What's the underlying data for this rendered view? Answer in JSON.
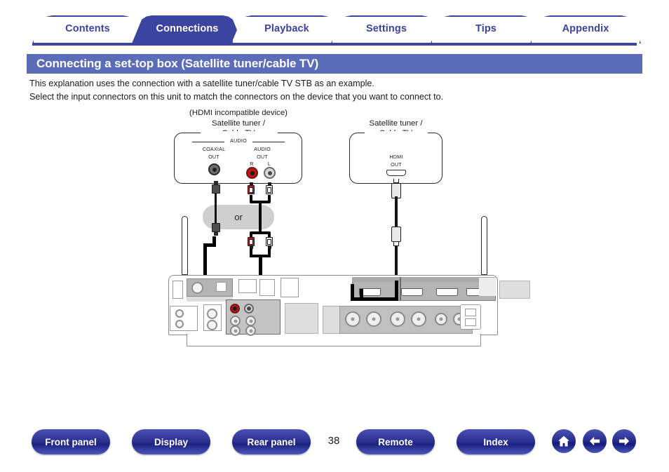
{
  "tabs": [
    {
      "label": "Contents",
      "active": false
    },
    {
      "label": "Connections",
      "active": true
    },
    {
      "label": "Playback",
      "active": false
    },
    {
      "label": "Settings",
      "active": false
    },
    {
      "label": "Tips",
      "active": false
    },
    {
      "label": "Appendix",
      "active": false
    }
  ],
  "title": "Connecting a set-top box (Satellite tuner/cable TV)",
  "paragraphs": {
    "line1": "This explanation uses the connection with a satellite tuner/cable TV STB as an example.",
    "line2": "Select the input connectors on this unit to match the connectors on the device that you want to connect to."
  },
  "diagram": {
    "left_device": {
      "note": "(HDMI incompatible device)",
      "name_line1": "Satellite tuner /",
      "name_line2": "Cable TV",
      "group_label": "AUDIO",
      "coaxial_out_line1": "COAXIAL",
      "coaxial_out_line2": "OUT",
      "audio_out_line1": "AUDIO",
      "audio_out_line2": "OUT",
      "channel_r": "R",
      "channel_l": "L"
    },
    "right_device": {
      "name_line1": "Satellite tuner /",
      "name_line2": "Cable TV",
      "hdmi_out_line1": "HDMI",
      "hdmi_out_line2": "OUT"
    },
    "or_label": "or"
  },
  "bottom_nav": {
    "buttons": [
      {
        "label": "Front panel"
      },
      {
        "label": "Display"
      },
      {
        "label": "Rear panel"
      },
      {
        "label": "Remote"
      },
      {
        "label": "Index"
      }
    ],
    "page_number": "38",
    "icons": [
      {
        "name": "home-icon"
      },
      {
        "name": "arrow-left-icon"
      },
      {
        "name": "arrow-right-icon"
      }
    ]
  },
  "colors": {
    "accent_blue": "#3b44a0",
    "title_bar": "#5b6cb8",
    "button_blue": "#2b2f8e",
    "cable_black": "#141414",
    "rca_red": "#b81818"
  }
}
